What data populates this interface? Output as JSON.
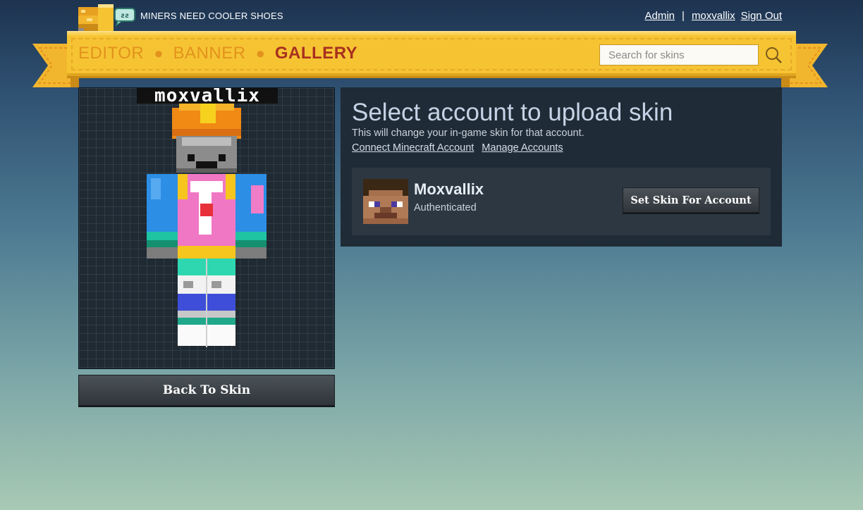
{
  "header": {
    "tagline": "MINERS NEED COOLER SHOES",
    "links": {
      "admin": "Admin",
      "separator": "|",
      "username": "moxvallix",
      "signout": "Sign Out"
    }
  },
  "nav": {
    "items": [
      {
        "label": "EDITOR",
        "active": false
      },
      {
        "label": "BANNER",
        "active": false
      },
      {
        "label": "GALLERY",
        "active": true
      }
    ],
    "dot": "●",
    "search_placeholder": "Search for skins",
    "search_icon": "search-icon"
  },
  "skin": {
    "name": "moxvallix",
    "back_label": "Back To Skin"
  },
  "account_panel": {
    "title": "Select account to upload skin",
    "subtitle": "This will change your in-game skin for that account.",
    "link_connect": "Connect Minecraft Account",
    "link_manage": "Manage Accounts",
    "account": {
      "name": "Moxvallix",
      "status": "Authenticated",
      "action_label": "Set Skin For Account"
    }
  },
  "colors": {
    "nav_gold": "#f6c433",
    "nav_link": "#e3921c",
    "nav_active": "#a8301f",
    "panel_bg": "#1f2b36",
    "card_bg": "#2c3742"
  }
}
